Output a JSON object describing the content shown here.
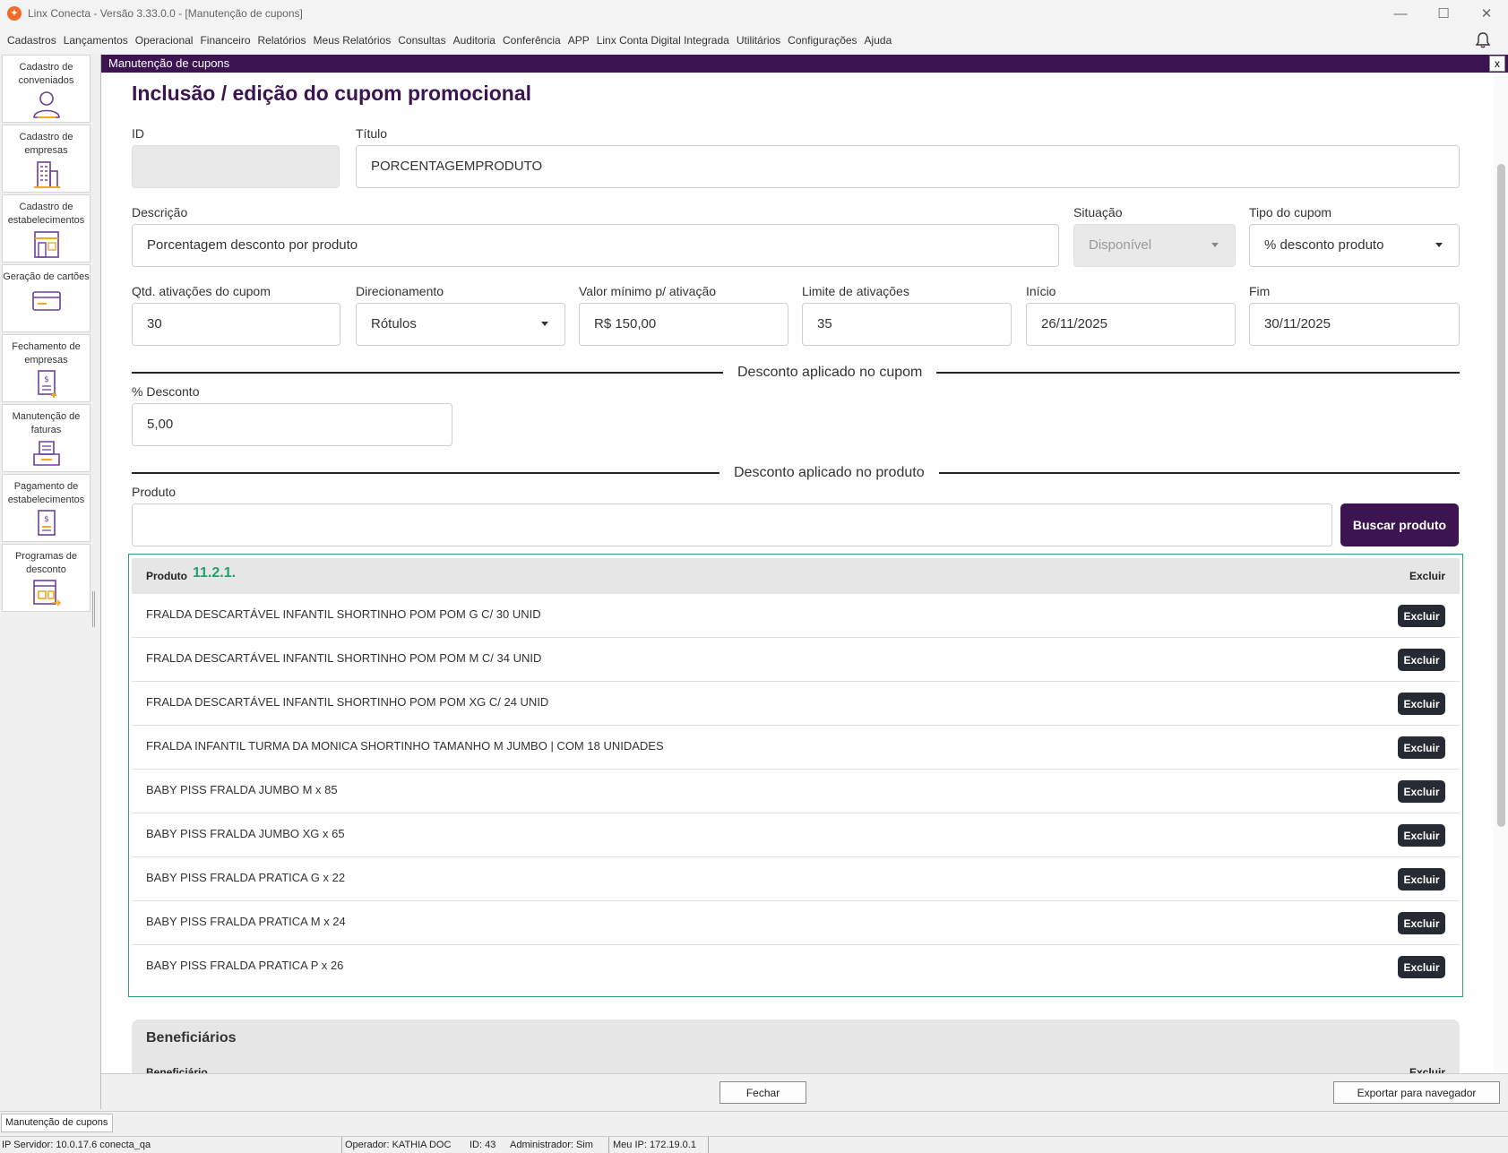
{
  "window": {
    "title": "Linx Conecta - Versão 3.33.0.0 - [Manutenção de cupons]",
    "minimize": "—",
    "maximize": "☐",
    "close": "✕"
  },
  "menu": [
    "Cadastros",
    "Lançamentos",
    "Operacional",
    "Financeiro",
    "Relatórios",
    "Meus Relatórios",
    "Consultas",
    "Auditoria",
    "Conferência",
    "APP",
    "Linx Conta Digital Integrada",
    "Utilitários",
    "Configurações",
    "Ajuda"
  ],
  "sidebar": [
    {
      "label": "Cadastro de conveniados",
      "icon": "user-icon"
    },
    {
      "label": "Cadastro de empresas",
      "icon": "building-icon"
    },
    {
      "label": "Cadastro de estabelecimentos",
      "icon": "store-icon"
    },
    {
      "label": "Geração de cartões",
      "icon": "card-icon"
    },
    {
      "label": "Fechamento de empresas",
      "icon": "invoice-plus-icon"
    },
    {
      "label": "Manutenção de faturas",
      "icon": "tray-icon"
    },
    {
      "label": "Pagamento de estabelecimentos",
      "icon": "payment-icon"
    },
    {
      "label": "Programas de desconto",
      "icon": "discount-program-icon"
    }
  ],
  "mdi": {
    "title": "Manutenção de cupons",
    "close": "x"
  },
  "form": {
    "heading": "Inclusão / edição do cupom promocional",
    "id_label": "ID",
    "id_value": "",
    "titulo_label": "Título",
    "titulo_value": "PORCENTAGEMPRODUTO",
    "descricao_label": "Descrição",
    "descricao_value": "Porcentagem desconto por produto",
    "situacao_label": "Situação",
    "situacao_value": "Disponível",
    "tipo_label": "Tipo do cupom",
    "tipo_value": "% desconto produto",
    "qtd_label": "Qtd. ativações do cupom",
    "qtd_value": "30",
    "direc_label": "Direcionamento",
    "direc_value": "Rótulos",
    "valor_label": "Valor mínimo p/ ativação",
    "valor_value": "R$ 150,00",
    "limite_label": "Limite de ativações",
    "limite_value": "35",
    "inicio_label": "Início",
    "inicio_value": "26/11/2025",
    "fim_label": "Fim",
    "fim_value": "30/11/2025",
    "section_cupom": "Desconto aplicado no cupom",
    "desconto_label": "% Desconto",
    "desconto_value": "5,00",
    "section_produto": "Desconto aplicado no produto",
    "produto_label": "Produto",
    "produto_value": "",
    "buscar_label": "Buscar produto"
  },
  "products": {
    "col_produto": "Produto",
    "annotation": "11.2.1.",
    "col_excluir": "Excluir",
    "delete_label": "Excluir",
    "rows": [
      "FRALDA DESCARTÁVEL INFANTIL SHORTINHO POM POM G C/ 30 UNID",
      "FRALDA DESCARTÁVEL INFANTIL SHORTINHO POM POM M C/ 34 UNID",
      "FRALDA DESCARTÁVEL INFANTIL SHORTINHO POM POM XG C/ 24 UNID",
      "FRALDA INFANTIL TURMA DA MONICA SHORTINHO TAMANHO M JUMBO | COM 18 UNIDADES",
      "BABY PISS FRALDA JUMBO M x 85",
      "BABY PISS FRALDA JUMBO XG x 65",
      "BABY PISS FRALDA PRATICA G x 22",
      "BABY PISS FRALDA PRATICA M x 24",
      "BABY PISS FRALDA PRATICA P x 26"
    ]
  },
  "beneficiarios": {
    "title": "Beneficiários",
    "col": "Beneficiário",
    "col_excluir": "Excluir"
  },
  "footer": {
    "fechar": "Fechar",
    "exportar": "Exportar para navegador"
  },
  "taskbar": {
    "tab": "Manutenção de cupons"
  },
  "status": {
    "servidor": "IP Servidor: 10.0.17.6 conecta_qa",
    "operador": "Operador: KATHIA DOC",
    "id": "ID: 43",
    "admin": "Administrador: Sim",
    "meu_ip": "Meu IP: 172.19.0.1"
  },
  "colors": {
    "brand": "#3b1451",
    "accent": "#22a06b",
    "icon_purple": "#6b3fa0",
    "icon_orange": "#f5a623"
  }
}
